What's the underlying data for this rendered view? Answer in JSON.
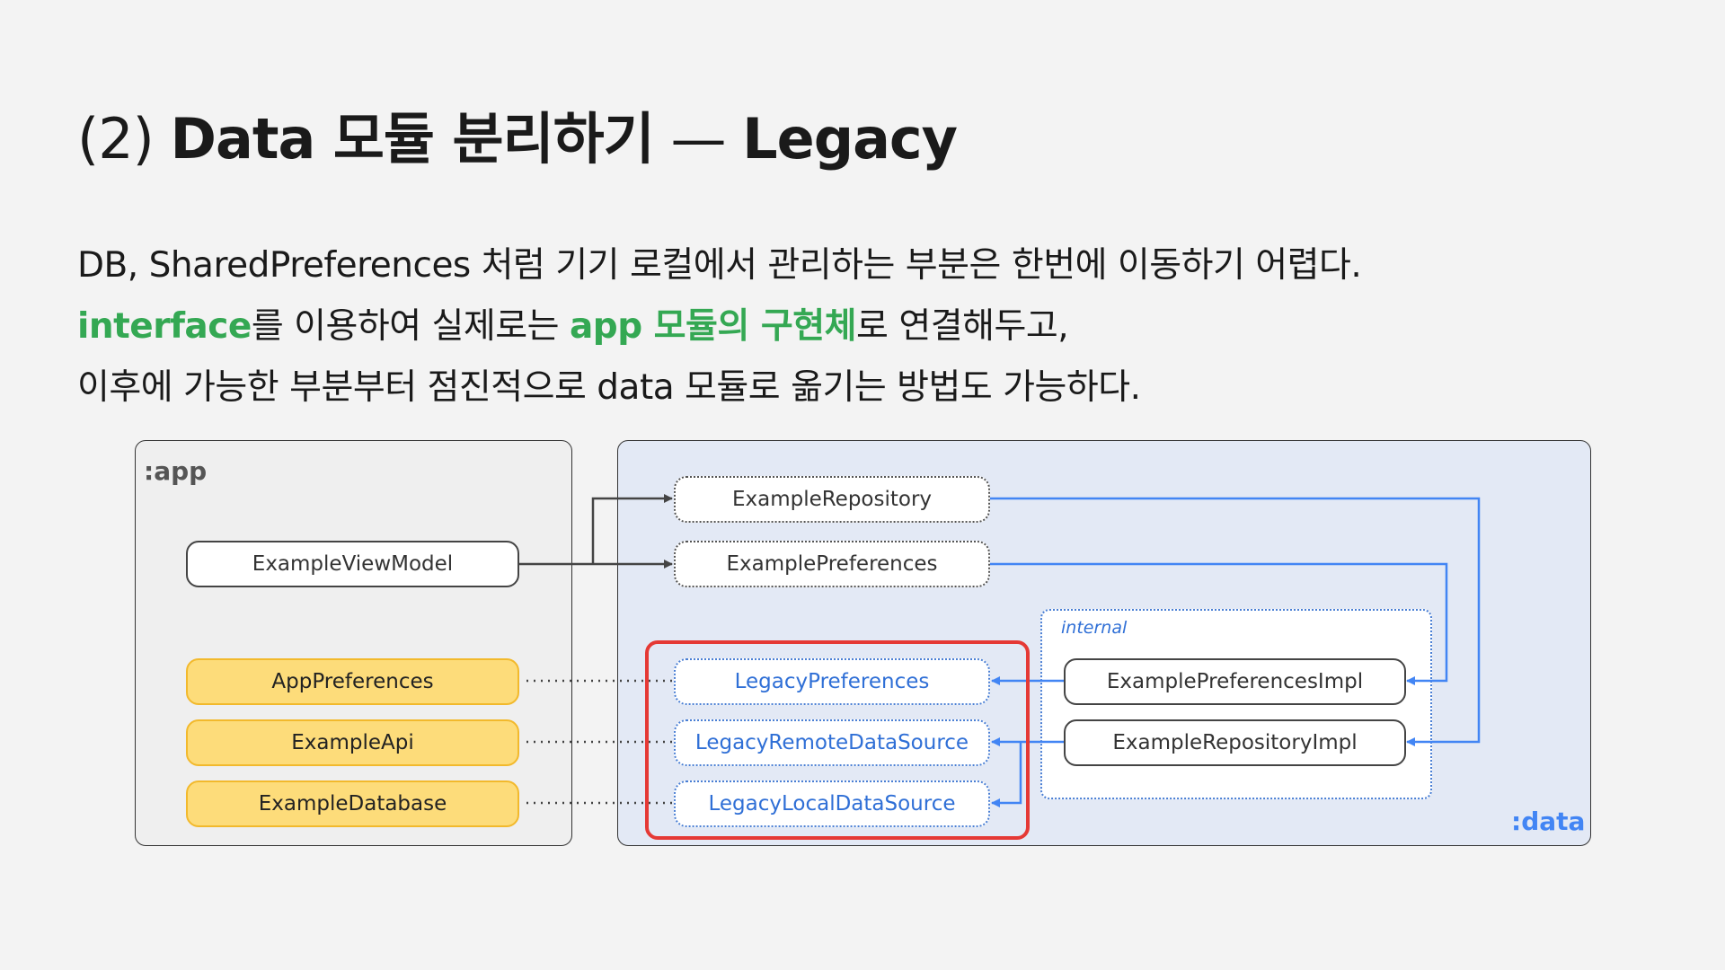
{
  "title": {
    "prefix": "(2) ",
    "bold": "Data 모듈 분리하기",
    "dash": " — ",
    "suffix": "Legacy"
  },
  "description": {
    "line1": "DB, SharedPreferences 처럼 기기 로컬에서 관리하는 부분은 한번에 이동하기 어렵다.",
    "line2_hl1": "interface",
    "line2_mid": "를 이용하여 실제로는 ",
    "line2_hl2": "app 모듈의 구현체",
    "line2_end": "로 연결해두고,",
    "line3": "이후에 가능한 부분부터 점진적으로 data 모듈로 옮기는 방법도 가능하다."
  },
  "diagram": {
    "app_module_label": ":app",
    "data_module_label": ":data",
    "internal_label": "internal",
    "nodes": {
      "example_view_model": "ExampleViewModel",
      "app_preferences": "AppPreferences",
      "example_api": "ExampleApi",
      "example_database": "ExampleDatabase",
      "example_repository": "ExampleRepository",
      "example_preferences": "ExamplePreferences",
      "legacy_preferences": "LegacyPreferences",
      "legacy_remote_data_source": "LegacyRemoteDataSource",
      "legacy_local_data_source": "LegacyLocalDataSource",
      "example_preferences_impl": "ExamplePreferencesImpl",
      "example_repository_impl": "ExampleRepositoryImpl"
    },
    "colors": {
      "accent_green": "#34a853",
      "blue": "#4285f4",
      "highlight_red": "#e53935",
      "yellow": "#fddc7a"
    }
  }
}
